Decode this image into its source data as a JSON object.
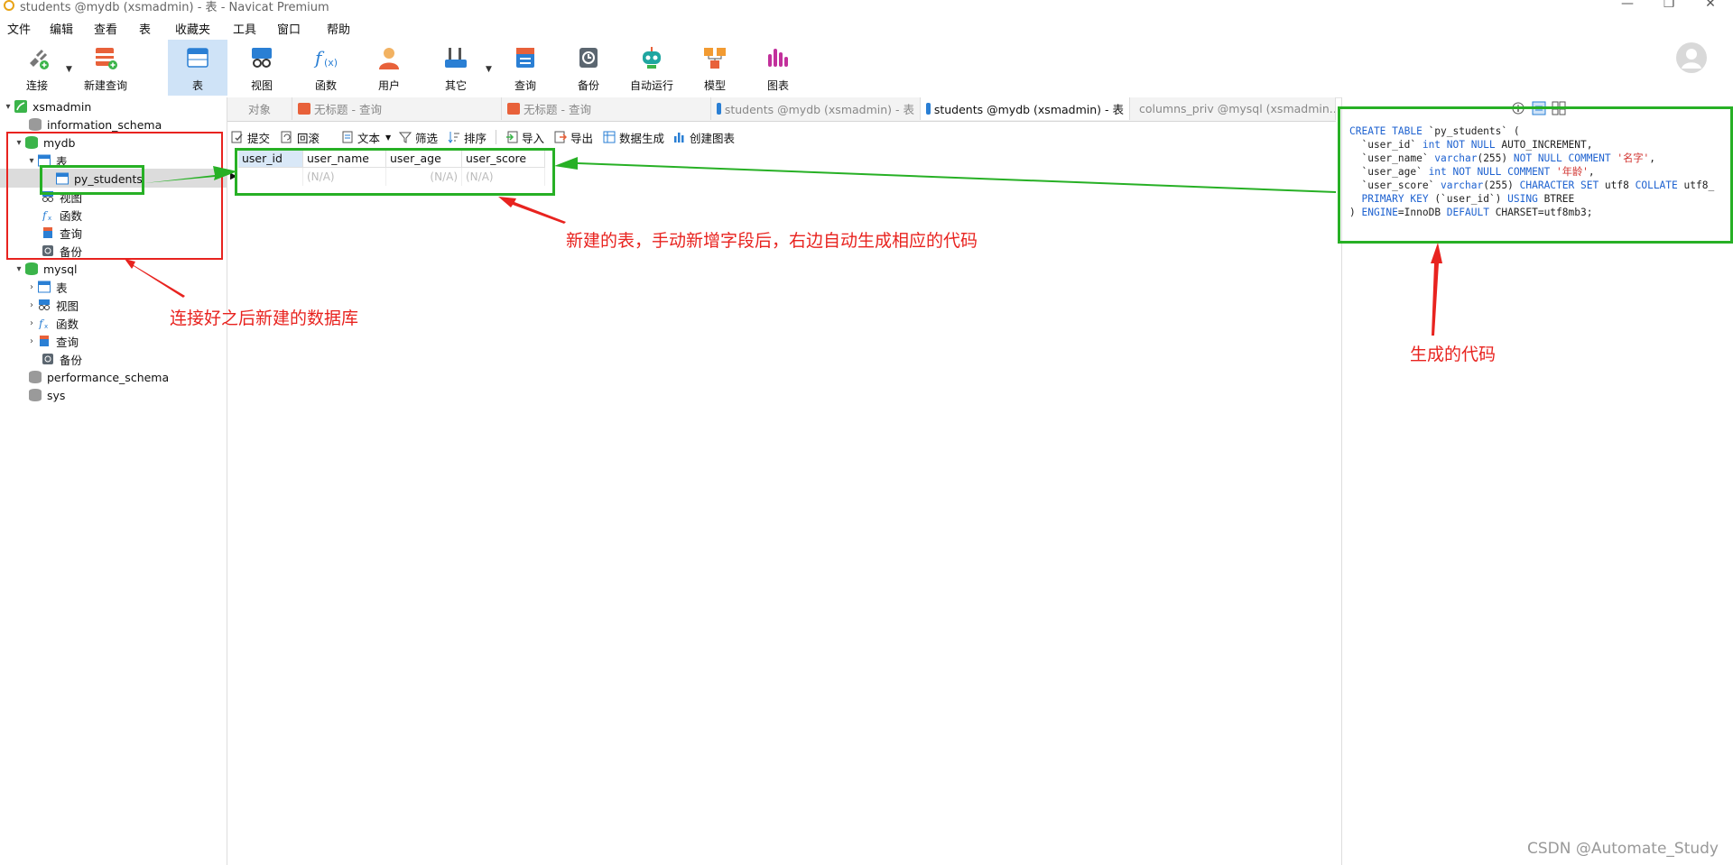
{
  "window": {
    "title": "students @mydb (xsmadmin) - 表 - Navicat Premium"
  },
  "menu": [
    "文件",
    "编辑",
    "查看",
    "表",
    "收藏夹",
    "工具",
    "窗口",
    "帮助"
  ],
  "toolbar": [
    {
      "label": "连接",
      "icon": "connect-icon"
    },
    {
      "label": "新建查询",
      "icon": "new-query-icon"
    },
    {
      "label": "表",
      "icon": "table-icon"
    },
    {
      "label": "视图",
      "icon": "view-icon"
    },
    {
      "label": "函数",
      "icon": "function-icon"
    },
    {
      "label": "用户",
      "icon": "user-icon"
    },
    {
      "label": "其它",
      "icon": "tools-icon"
    },
    {
      "label": "查询",
      "icon": "query-icon"
    },
    {
      "label": "备份",
      "icon": "backup-icon"
    },
    {
      "label": "自动运行",
      "icon": "automation-icon"
    },
    {
      "label": "模型",
      "icon": "model-icon"
    },
    {
      "label": "图表",
      "icon": "chart-icon"
    }
  ],
  "sidebar": {
    "items": [
      {
        "label": "xsmadmin",
        "type": "connection",
        "expanded": true
      },
      {
        "label": "information_schema",
        "type": "database"
      },
      {
        "label": "mydb",
        "type": "database",
        "expanded": true
      },
      {
        "label": "表",
        "type": "tables",
        "expanded": true
      },
      {
        "label": "py_students",
        "type": "table",
        "selected": true
      },
      {
        "label": "视图",
        "type": "views"
      },
      {
        "label": "函数",
        "type": "functions"
      },
      {
        "label": "查询",
        "type": "queries"
      },
      {
        "label": "备份",
        "type": "backups"
      },
      {
        "label": "mysql",
        "type": "database",
        "expanded": true
      },
      {
        "label": "表",
        "type": "tables"
      },
      {
        "label": "视图",
        "type": "views"
      },
      {
        "label": "函数",
        "type": "functions"
      },
      {
        "label": "查询",
        "type": "queries"
      },
      {
        "label": "备份",
        "type": "backups"
      },
      {
        "label": "performance_schema",
        "type": "database"
      },
      {
        "label": "sys",
        "type": "database"
      }
    ]
  },
  "tabs": [
    {
      "label": "对象",
      "active": false
    },
    {
      "label": "无标题 - 查询",
      "active": false
    },
    {
      "label": "无标题 - 查询",
      "active": false
    },
    {
      "label": "students @mydb (xsmadmin) - 表",
      "active": false
    },
    {
      "label": "students @mydb (xsmadmin) - 表",
      "active": true
    },
    {
      "label": "columns_priv @mysql (xsmadmin...",
      "active": false
    }
  ],
  "subtoolbar": [
    "提交",
    "回滚",
    "文本",
    "筛选",
    "排序",
    "导入",
    "导出",
    "数据生成",
    "创建图表"
  ],
  "grid": {
    "columns": [
      "user_id",
      "user_name",
      "user_age",
      "user_score"
    ],
    "rows": [
      [
        "",
        "(N/A)",
        "(N/A)",
        "(N/A)"
      ]
    ]
  },
  "sql_lines": [
    "CREATE TABLE `py_students` (",
    "  `user_id` int NOT NULL AUTO_INCREMENT,",
    "  `user_name` varchar(255) NOT NULL COMMENT '名字',",
    "  `user_age` int NOT NULL COMMENT '年龄',",
    "  `user_score` varchar(255) CHARACTER SET utf8 COLLATE utf8_",
    "  PRIMARY KEY (`user_id`) USING BTREE",
    ") ENGINE=InnoDB DEFAULT CHARSET=utf8mb3;"
  ],
  "annotations": {
    "db_note": "连接好之后新建的数据库",
    "table_note": "新建的表，手动新增字段后，右边自动生成相应的代码",
    "code_note": "生成的代码"
  },
  "watermark": "CSDN @Automate_Study",
  "colors": {
    "annotation_red": "#e8231f",
    "annotation_green": "#27b025",
    "sql_keyword": "#1e62d0",
    "sql_string": "#d0312d",
    "active_tool_bg": "#cfe3f7"
  }
}
